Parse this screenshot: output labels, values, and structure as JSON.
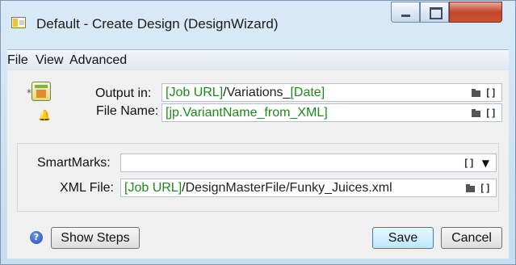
{
  "window": {
    "title": "Default - Create Design (DesignWizard)",
    "controls": {
      "minimize_icon": "minimize-icon",
      "maximize_icon": "maximize-icon",
      "close_icon": "close-icon",
      "close_glyph": "X"
    }
  },
  "menu": {
    "items": [
      "File",
      "View",
      "Advanced"
    ]
  },
  "output": {
    "label": "Output in:",
    "value_var1": "[Job URL]",
    "value_text": "/Variations_",
    "value_var2": "[Date]"
  },
  "filename": {
    "label": "File Name:",
    "value_var": "[jp.VariantName_from_XML]"
  },
  "smartmarks": {
    "label": "SmartMarks:",
    "value": ""
  },
  "xmlfile": {
    "label": "XML File:",
    "value_var": "[Job URL]",
    "value_text": "/DesignMasterFile/Funky_Juices.xml"
  },
  "icons": {
    "folder": "folder-icon",
    "variable": "variable-bracket-icon",
    "bracket_glyph": "[]",
    "caret_glyph": "▼",
    "help_glyph": "?",
    "bell_glyph": "🔔",
    "star_glyph": "*"
  },
  "buttons": {
    "show_steps": "Show Steps",
    "save": "Save",
    "cancel": "Cancel"
  },
  "colors": {
    "variable_text": "#1d8a1d",
    "close_button": "#c2442e",
    "primary_button": "#bde6fd"
  }
}
